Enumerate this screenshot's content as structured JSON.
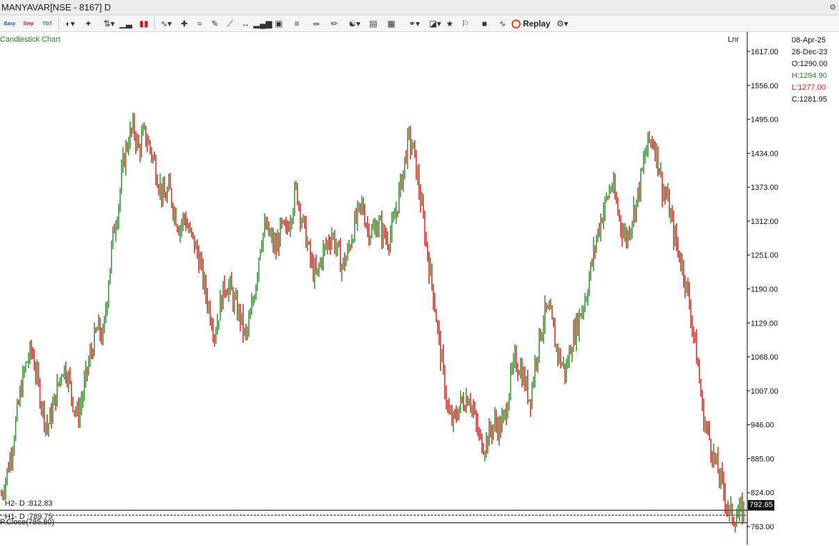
{
  "window": {
    "title": "MANYAVAR[NSE - 8167] D"
  },
  "toolbar": {
    "easy_label": "Easy",
    "step_label": "Step",
    "tgt_label": "TGT",
    "replay_label": "Replay"
  },
  "chart": {
    "type_label": "Candlestick Chart",
    "scale_label": "Lnr",
    "current_price_label": "792.65",
    "levels": [
      {
        "label": "H2- D :812.83",
        "value": 812.83
      },
      {
        "label": "H1- D :789.75",
        "value": 789.75
      }
    ],
    "prev_close": {
      "label": "P.Close(785.80)",
      "value": 785.8
    }
  },
  "ohlc_panel": {
    "date1": "08-Apr-25",
    "date2": "26-Dec-23",
    "open": "O:1290.00",
    "high": "H:1294.90",
    "low": "L:1277.00",
    "close": "C:1281.95"
  },
  "colors": {
    "up": "#1f8a1f",
    "down": "#e01010",
    "axis": "#000000"
  },
  "chart_data": {
    "type": "candlestick",
    "y_ticks": [
      "1617.00",
      "1556.00",
      "1495.00",
      "1434.00",
      "1373.00",
      "1312.00",
      "1251.00",
      "1190.00",
      "1129.00",
      "1068.00",
      "1007.00",
      "946.00",
      "885.00",
      "824.00",
      "763.00"
    ],
    "ylim": [
      740,
      1640
    ],
    "close_series": [
      820,
      855,
      900,
      960,
      1020,
      1060,
      1080,
      1030,
      980,
      940,
      970,
      1010,
      1050,
      1040,
      990,
      960,
      1000,
      1050,
      1090,
      1120,
      1100,
      1200,
      1290,
      1340,
      1420,
      1460,
      1480,
      1440,
      1470,
      1450,
      1420,
      1380,
      1350,
      1370,
      1330,
      1300,
      1320,
      1290,
      1270,
      1240,
      1190,
      1150,
      1110,
      1160,
      1200,
      1190,
      1160,
      1140,
      1100,
      1140,
      1200,
      1280,
      1300,
      1280,
      1260,
      1300,
      1290,
      1330,
      1370,
      1320,
      1280,
      1230,
      1210,
      1250,
      1270,
      1290,
      1260,
      1230,
      1250,
      1290,
      1320,
      1340,
      1300,
      1290,
      1310,
      1290,
      1280,
      1300,
      1350,
      1400,
      1460,
      1440,
      1380,
      1310,
      1240,
      1180,
      1100,
      1030,
      960,
      950,
      980,
      990,
      1000,
      960,
      920,
      910,
      930,
      950,
      940,
      960,
      1020,
      1060,
      1050,
      1020,
      990,
      1060,
      1110,
      1150,
      1140,
      1090,
      1060,
      1040,
      1090,
      1120,
      1150,
      1180,
      1230,
      1280,
      1320,
      1350,
      1380,
      1340,
      1300,
      1280,
      1320,
      1350,
      1400,
      1450,
      1460,
      1430,
      1370,
      1350,
      1300,
      1260,
      1230,
      1180,
      1120,
      1050,
      960,
      930,
      890,
      860,
      830,
      790,
      780,
      785,
      792.65
    ]
  }
}
